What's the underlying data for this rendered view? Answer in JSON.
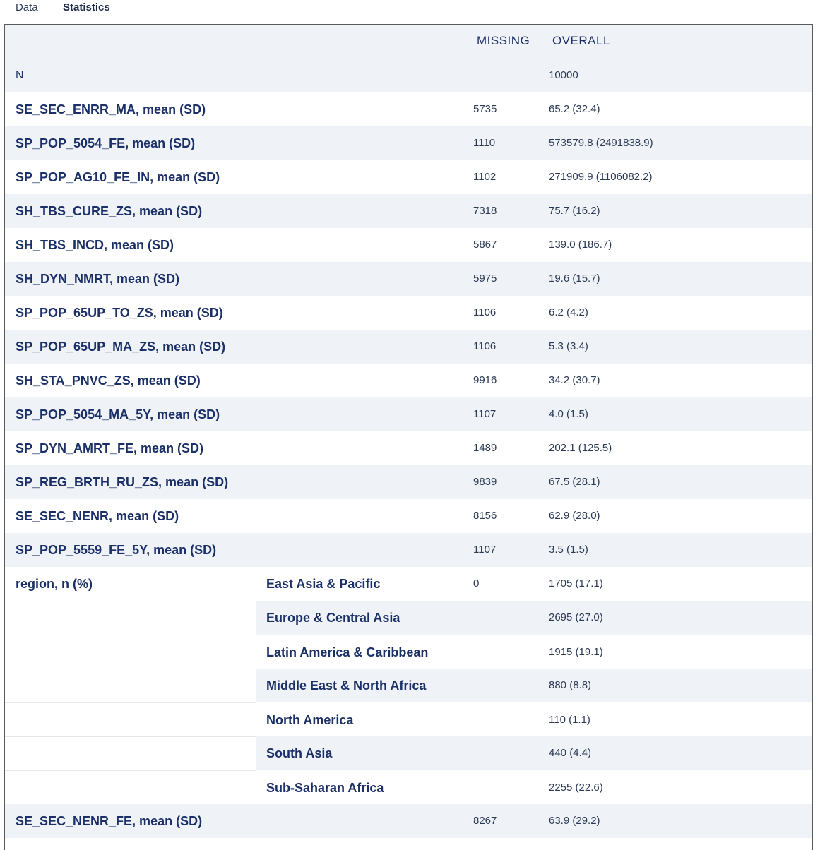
{
  "tabs": [
    {
      "label": "Data"
    },
    {
      "label": "Statistics"
    }
  ],
  "table": {
    "headers": {
      "missing": "MISSING",
      "overall": "OVERALL"
    },
    "n_row": {
      "label": "N",
      "overall": "10000"
    },
    "rows": [
      {
        "label": "SE_SEC_ENRR_MA, mean (SD)",
        "missing": "5735",
        "overall": "65.2 (32.4)"
      },
      {
        "label": "SP_POP_5054_FE, mean (SD)",
        "missing": "1110",
        "overall": "573579.8 (2491838.9)"
      },
      {
        "label": "SP_POP_AG10_FE_IN, mean (SD)",
        "missing": "1102",
        "overall": "271909.9 (1106082.2)"
      },
      {
        "label": "SH_TBS_CURE_ZS, mean (SD)",
        "missing": "7318",
        "overall": "75.7 (16.2)"
      },
      {
        "label": "SH_TBS_INCD, mean (SD)",
        "missing": "5867",
        "overall": "139.0 (186.7)"
      },
      {
        "label": "SH_DYN_NMRT, mean (SD)",
        "missing": "5975",
        "overall": "19.6 (15.7)"
      },
      {
        "label": "SP_POP_65UP_TO_ZS, mean (SD)",
        "missing": "1106",
        "overall": "6.2 (4.2)"
      },
      {
        "label": "SP_POP_65UP_MA_ZS, mean (SD)",
        "missing": "1106",
        "overall": "5.3 (3.4)"
      },
      {
        "label": "SH_STA_PNVC_ZS, mean (SD)",
        "missing": "9916",
        "overall": "34.2 (30.7)"
      },
      {
        "label": "SP_POP_5054_MA_5Y, mean (SD)",
        "missing": "1107",
        "overall": "4.0 (1.5)"
      },
      {
        "label": "SP_DYN_AMRT_FE, mean (SD)",
        "missing": "1489",
        "overall": "202.1 (125.5)"
      },
      {
        "label": "SP_REG_BRTH_RU_ZS, mean (SD)",
        "missing": "9839",
        "overall": "67.5 (28.1)"
      },
      {
        "label": "SE_SEC_NENR, mean (SD)",
        "missing": "8156",
        "overall": "62.9 (28.0)"
      },
      {
        "label": "SP_POP_5559_FE_5Y, mean (SD)",
        "missing": "1107",
        "overall": "3.5 (1.5)"
      }
    ],
    "region": {
      "label": "region, n (%)",
      "missing": "0",
      "levels": [
        {
          "name": "East Asia & Pacific",
          "overall": "1705 (17.1)"
        },
        {
          "name": "Europe & Central Asia",
          "overall": "2695 (27.0)"
        },
        {
          "name": "Latin America & Caribbean",
          "overall": "1915 (19.1)"
        },
        {
          "name": "Middle East & North Africa",
          "overall": "880 (8.8)"
        },
        {
          "name": "North America",
          "overall": "110 (1.1)"
        },
        {
          "name": "South Asia",
          "overall": "440 (4.4)"
        },
        {
          "name": "Sub-Saharan Africa",
          "overall": "2255 (22.6)"
        }
      ]
    },
    "last_row": {
      "label": "SE_SEC_NENR_FE, mean (SD)",
      "missing": "8267",
      "overall": "63.9 (29.2)"
    }
  }
}
